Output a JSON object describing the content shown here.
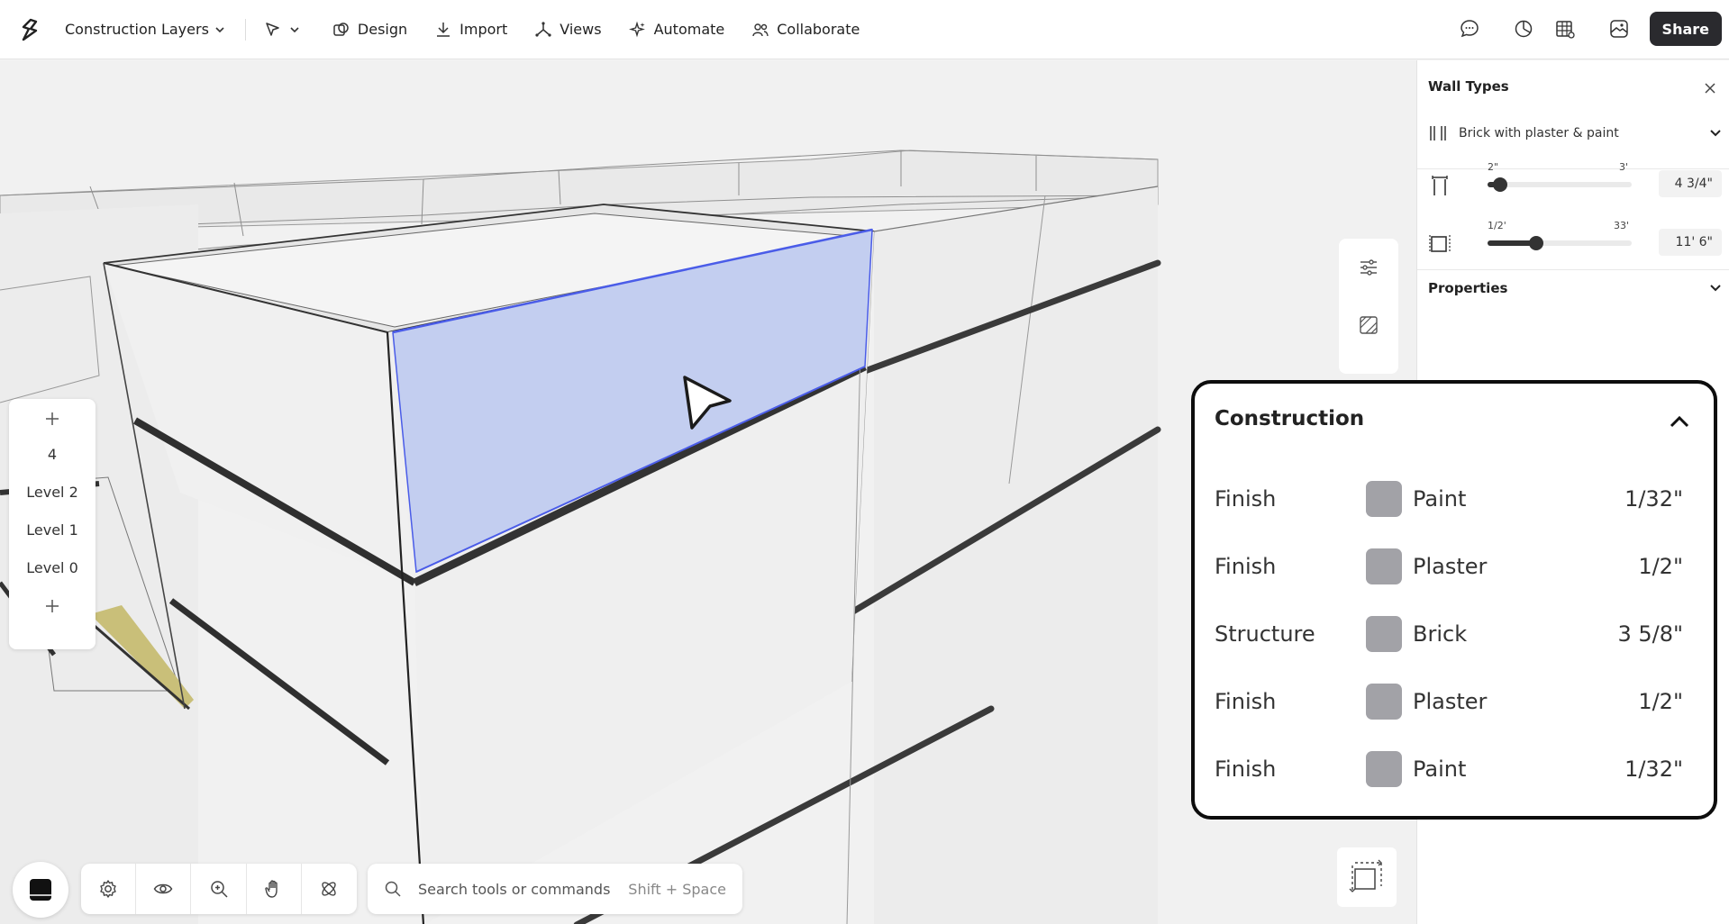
{
  "topbar": {
    "project_name": "Construction Layers",
    "tools": [
      {
        "label": "Design",
        "icon": "design-icon"
      },
      {
        "label": "Import",
        "icon": "import-icon"
      },
      {
        "label": "Views",
        "icon": "views-icon"
      },
      {
        "label": "Automate",
        "icon": "automate-icon"
      },
      {
        "label": "Collaborate",
        "icon": "collaborate-icon"
      }
    ],
    "share_label": "Share"
  },
  "levels": {
    "items": [
      "4",
      "Level 2",
      "Level 1",
      "Level 0"
    ]
  },
  "search": {
    "placeholder": "Search tools or commands",
    "shortcut": "Shift + Space"
  },
  "panel": {
    "title": "Wall Types",
    "wall_type": "Brick with plaster & paint",
    "thickness": {
      "min": "2\"",
      "max": "3'",
      "value": "4 3/4\"",
      "position": 0.09
    },
    "height": {
      "min": "1/2'",
      "max": "33'",
      "value": "11' 6\"",
      "position": 0.34
    },
    "properties_label": "Properties"
  },
  "construction": {
    "title": "Construction",
    "layers": [
      {
        "role": "Finish",
        "material": "Paint",
        "thickness": "1/32\""
      },
      {
        "role": "Finish",
        "material": "Plaster",
        "thickness": "1/2\""
      },
      {
        "role": "Structure",
        "material": "Brick",
        "thickness": "3 5/8\""
      },
      {
        "role": "Finish",
        "material": "Plaster",
        "thickness": "1/2\""
      },
      {
        "role": "Finish",
        "material": "Paint",
        "thickness": "1/32\""
      }
    ]
  },
  "colors": {
    "selection": "#c3cef0",
    "selection_edge": "#4a5ce8",
    "swatch": "#a2a2a7",
    "floor_highlight": "#c9bf79"
  }
}
